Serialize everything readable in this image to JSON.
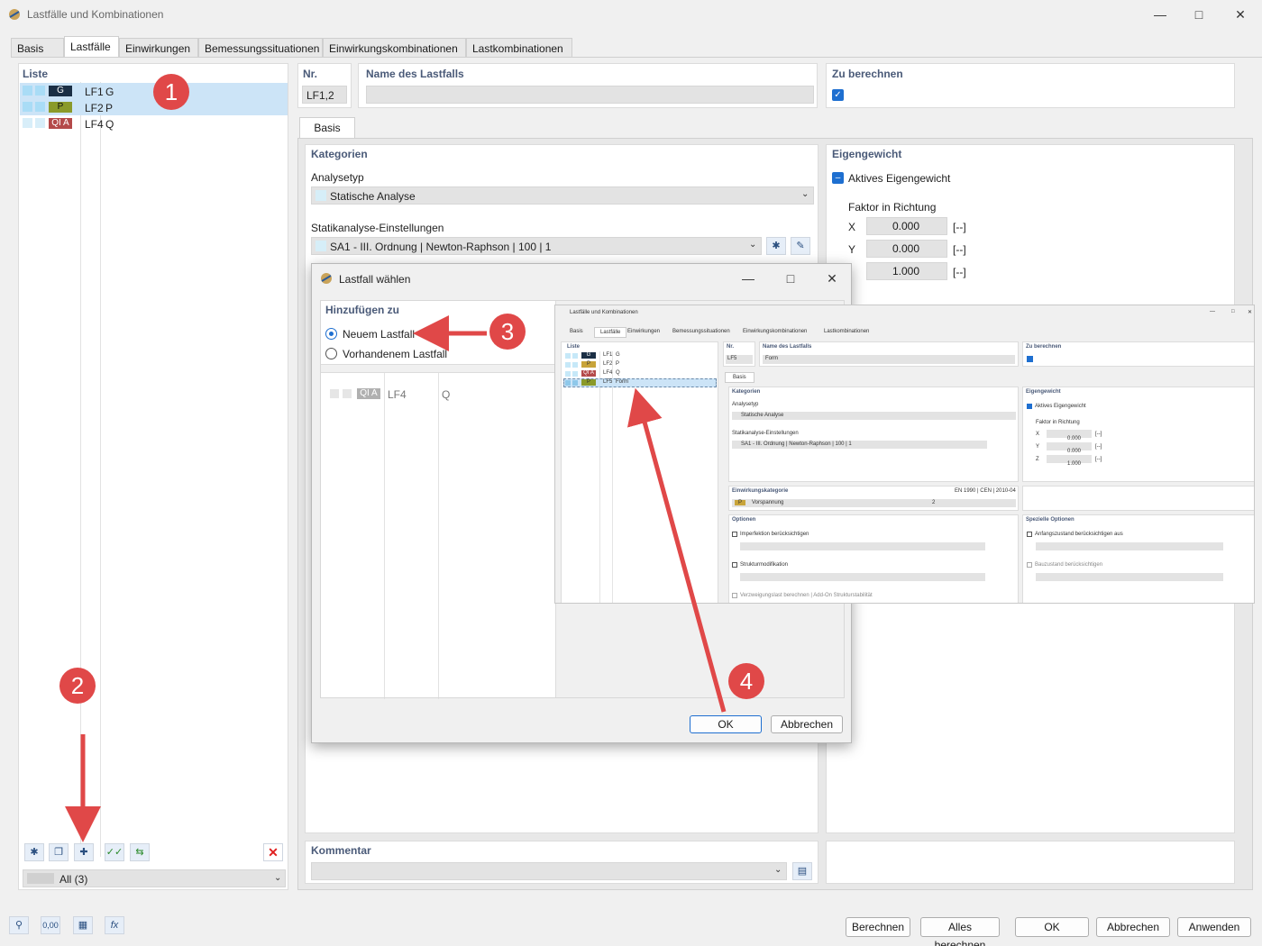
{
  "window": {
    "title": "Lastfälle und Kombinationen"
  },
  "tabs": [
    "Basis",
    "Lastfälle",
    "Einwirkungen",
    "Bemessungssituationen",
    "Einwirkungskombinationen",
    "Lastkombinationen"
  ],
  "left": {
    "list_label": "Liste",
    "items": [
      {
        "badge": "G",
        "badge_color": "#1b2f45",
        "name": "LF1",
        "type": "G",
        "selected": true
      },
      {
        "badge": "P",
        "badge_color": "#8a9a2a",
        "name": "LF2",
        "type": "P",
        "selected": true
      },
      {
        "badge": "QI A",
        "badge_color": "#b44a4a",
        "name": "LF4",
        "type": "Q",
        "selected": false
      }
    ],
    "filter_value": "All (3)"
  },
  "header": {
    "nr_label": "Nr.",
    "nr_value": "LF1,2",
    "name_label": "Name des Lastfalls",
    "name_value": "",
    "calc_label": "Zu berechnen"
  },
  "inner_tab": "Basis",
  "kategorien": {
    "label": "Kategorien",
    "analysetyp_label": "Analysetyp",
    "analysetyp_value": "Statische Analyse",
    "settings_label": "Statikanalyse-Einstellungen",
    "settings_value": "SA1 - III. Ordnung | Newton-Raphson | 100 | 1"
  },
  "eigengewicht": {
    "label": "Eigengewicht",
    "active_label": "Aktives Eigengewicht",
    "faktor_label": "Faktor in Richtung",
    "rows": [
      {
        "axis": "X",
        "value": "0.000",
        "unit": "[--]"
      },
      {
        "axis": "Y",
        "value": "0.000",
        "unit": "[--]"
      },
      {
        "axis": "",
        "value": "1.000",
        "unit": "[--]"
      }
    ]
  },
  "kommentar": {
    "label": "Kommentar"
  },
  "bottom_buttons": [
    "Berechnen",
    "Alles berechnen",
    "OK",
    "Abbrechen",
    "Anwenden"
  ],
  "dialog": {
    "title": "Lastfall wählen",
    "section": "Hinzufügen zu",
    "option1": "Neuem Lastfall",
    "option2": "Vorhandenem Lastfall",
    "row": {
      "badge": "QI A",
      "name": "LF4",
      "type": "Q"
    },
    "ok": "OK",
    "cancel": "Abbrechen"
  },
  "preview": {
    "title": "Lastfälle und Kombinationen",
    "tabs": [
      "Basis",
      "Lastfälle",
      "Einwirkungen",
      "Bemessungssituationen",
      "Einwirkungskombinationen",
      "Lastkombinationen"
    ],
    "list_label": "Liste",
    "items": [
      {
        "badge": "G",
        "name": "LF1",
        "type": "G"
      },
      {
        "badge": "P",
        "name": "LF2",
        "type": "P"
      },
      {
        "badge": "QI A",
        "name": "LF4",
        "type": "Q"
      },
      {
        "badge": "P",
        "name": "LF5",
        "type": "Form"
      }
    ],
    "nr_label": "Nr.",
    "nr_value": "LF5",
    "name_label": "Name des Lastfalls",
    "name_value": "Form",
    "calc_label": "Zu berechnen",
    "inner_tab": "Basis",
    "kategorien": "Kategorien",
    "analysetyp_label": "Analysetyp",
    "analysetyp_value": "Statische Analyse",
    "settings_label": "Statikanalyse-Einstellungen",
    "settings_value": "SA1 - III. Ordnung | Newton-Raphson | 100 | 1",
    "eigengewicht": "Eigengewicht",
    "active": "Aktives Eigengewicht",
    "faktor": "Faktor in Richtung",
    "factors": [
      {
        "axis": "X",
        "value": "0.000",
        "unit": "[--]"
      },
      {
        "axis": "Y",
        "value": "0.000",
        "unit": "[--]"
      },
      {
        "axis": "Z",
        "value": "1.000",
        "unit": "[--]"
      }
    ],
    "einwirkungskategorie": "Einwirkungskategorie",
    "norm": "EN 1990 | CEN | 2010-04",
    "kat_badge": "P",
    "kat_value": "Vorspannung",
    "kat_num": "2",
    "optionen": "Optionen",
    "opt1": "Imperfektion berücksichtigen",
    "opt2": "Strukturmodifikation",
    "opt3": "Verzweigungslast berechnen | Add-On Strukturstabilität",
    "spezielle": "Spezielle Optionen",
    "sp1": "Anfangszustand berücksichtigen aus",
    "sp2": "Bauzustand berücksichtigen"
  },
  "callouts": [
    "1",
    "2",
    "3",
    "4"
  ]
}
